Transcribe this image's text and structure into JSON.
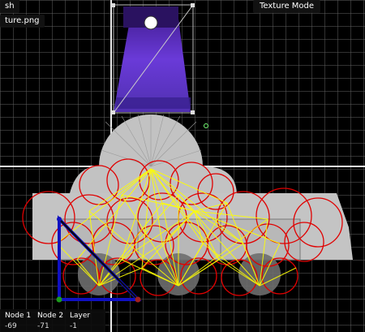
{
  "editor": {
    "mode_label": "Texture Mode",
    "mesh_label": "sh",
    "texture_label": "ture.png"
  },
  "hud": {
    "headers": [
      "Node 1",
      "Node 2",
      "Layer"
    ],
    "values": [
      "-69",
      "-71",
      "-1"
    ]
  },
  "colors": {
    "background": "#000000",
    "mesh_fill": "#c4c4c4",
    "bone_circles": "#e00000",
    "weights": "#ffff00",
    "triangle": "#1010c0",
    "texture": "#5b2fc8"
  },
  "icons": [
    "texture-sprite",
    "bone-triangle",
    "circle-handle",
    "node-handle"
  ]
}
